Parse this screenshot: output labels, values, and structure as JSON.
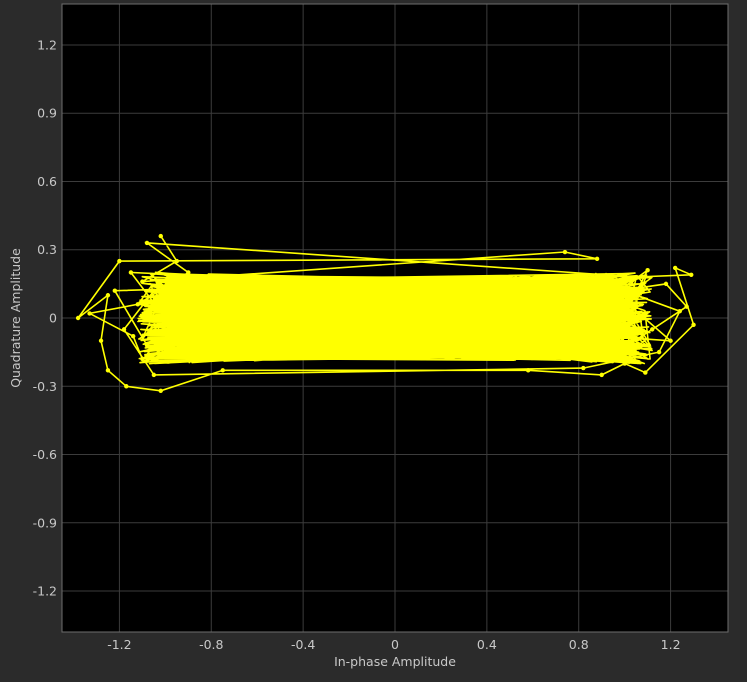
{
  "chart_data": {
    "type": "line",
    "title": "",
    "xlabel": "In-phase Amplitude",
    "ylabel": "Quadrature Amplitude",
    "xlim": [
      -1.45,
      1.45
    ],
    "ylim": [
      -1.38,
      1.38
    ],
    "xticks": [
      -1.2,
      -0.8,
      -0.4,
      0,
      0.4,
      0.8,
      1.2
    ],
    "yticks": [
      1.2,
      0.9,
      0.6,
      0.3,
      0,
      -0.3,
      -0.6,
      -0.9,
      -1.2
    ],
    "xtick_labels": [
      "-1.2",
      "-0.8",
      "-0.4",
      "0",
      "0.4",
      "0.8",
      "1.2"
    ],
    "ytick_labels": [
      "1.2",
      "0.9",
      "0.6",
      "0.3",
      "0",
      "-0.3",
      "-0.6",
      "-0.9",
      "-1.2"
    ],
    "grid": true,
    "series": [
      {
        "color": "#ffff00",
        "markers": true,
        "points": [
          [
            -1.02,
            0.36
          ],
          [
            -0.95,
            0.25
          ],
          [
            -1.1,
            0.16
          ],
          [
            0.74,
            0.29
          ],
          [
            0.88,
            0.26
          ],
          [
            -1.2,
            0.25
          ],
          [
            -1.38,
            0.0
          ],
          [
            -1.25,
            0.1
          ],
          [
            -1.28,
            -0.1
          ],
          [
            -1.25,
            -0.23
          ],
          [
            -1.17,
            -0.3
          ],
          [
            -1.02,
            -0.32
          ],
          [
            -0.75,
            -0.23
          ],
          [
            0.58,
            -0.23
          ],
          [
            0.9,
            -0.25
          ],
          [
            1.0,
            -0.2
          ],
          [
            1.09,
            -0.24
          ],
          [
            1.3,
            -0.03
          ],
          [
            1.22,
            0.22
          ],
          [
            1.29,
            0.19
          ],
          [
            1.05,
            0.18
          ],
          [
            -1.08,
            0.33
          ],
          [
            -0.9,
            0.2
          ],
          [
            -1.12,
            0.06
          ],
          [
            -1.33,
            0.02
          ],
          [
            -1.14,
            -0.08
          ],
          [
            -1.1,
            -0.18
          ],
          [
            -0.98,
            -0.14
          ],
          [
            0.95,
            -0.16
          ],
          [
            1.12,
            -0.05
          ],
          [
            1.27,
            0.05
          ],
          [
            1.18,
            0.15
          ],
          [
            0.98,
            0.12
          ],
          [
            -1.05,
            0.12
          ],
          [
            -1.18,
            -0.05
          ],
          [
            -1.05,
            -0.25
          ],
          [
            0.82,
            -0.22
          ],
          [
            1.15,
            -0.15
          ],
          [
            1.24,
            0.03
          ],
          [
            1.05,
            0.1
          ],
          [
            -1.15,
            0.2
          ],
          [
            -1.0,
            0.0
          ],
          [
            0.92,
            0.08
          ],
          [
            1.1,
            0.21
          ],
          [
            0.95,
            -0.08
          ],
          [
            -1.08,
            -0.12
          ],
          [
            -1.22,
            0.12
          ],
          [
            0.88,
            0.18
          ],
          [
            1.2,
            -0.1
          ],
          [
            -0.95,
            0.05
          ]
        ]
      }
    ]
  }
}
